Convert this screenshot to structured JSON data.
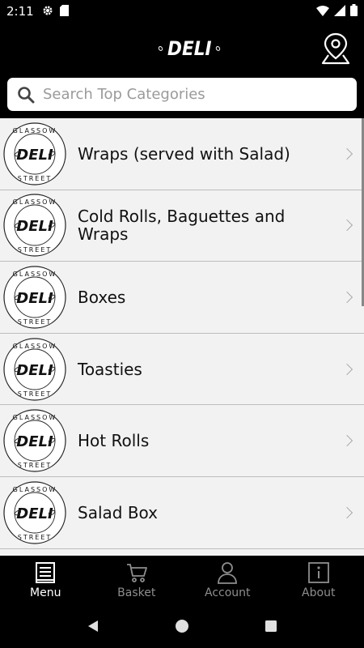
{
  "status": {
    "time": "2:11"
  },
  "header": {
    "logo_text": "DELI"
  },
  "search": {
    "placeholder": "Search Top Categories"
  },
  "badge": {
    "top_text": "GLASSOW",
    "bottom_text": "STREET",
    "center_text": "DELI"
  },
  "categories": [
    {
      "label": "Wraps (served with Salad)"
    },
    {
      "label": "Cold Rolls, Baguettes and Wraps"
    },
    {
      "label": "Boxes"
    },
    {
      "label": "Toasties"
    },
    {
      "label": "Hot Rolls"
    },
    {
      "label": "Salad Box"
    }
  ],
  "tabs": [
    {
      "label": "Menu",
      "icon": "menu-icon",
      "active": true
    },
    {
      "label": "Basket",
      "icon": "basket-icon"
    },
    {
      "label": "Account",
      "icon": "account-icon"
    },
    {
      "label": "About",
      "icon": "info-icon"
    }
  ],
  "colors": {
    "background": "#000000",
    "list_bg": "#f2f2f2",
    "active_tab": "#ffffff",
    "inactive_tab": "#8e8e8e"
  }
}
